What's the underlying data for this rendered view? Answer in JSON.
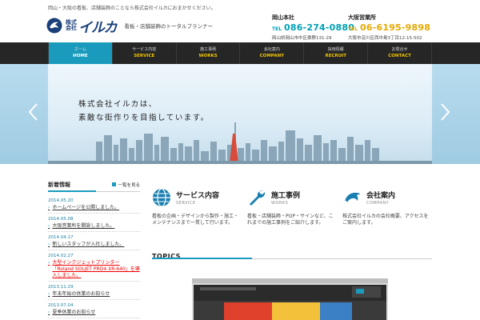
{
  "header": {
    "tagline": "岡山・大阪の看板、店舗装飾のことなら株式会社イルカにおまかせください。",
    "logo_corp": "株式会社",
    "logo_name": "イルカ",
    "logo_sub": "看板・店舗装飾のトータルプランナー",
    "offices": [
      {
        "title": "岡山本社",
        "tel_label": "TEL",
        "tel": "086-274-0880",
        "address": "岡山県岡山市中区桑野131-29",
        "color": "#00a0b8"
      },
      {
        "title": "大阪営業所",
        "tel_label": "TEL",
        "tel": "06-6195-9898",
        "address": "大阪市淀川区西中島3丁目12-15-502",
        "color": "#e6a800"
      }
    ]
  },
  "nav": {
    "items": [
      {
        "jp": "ホーム",
        "en": "HOME",
        "active": true
      },
      {
        "jp": "サービス内容",
        "en": "SERVICE"
      },
      {
        "jp": "施工事例",
        "en": "WORKS"
      },
      {
        "jp": "会社案内",
        "en": "COMPANY"
      },
      {
        "jp": "採用情報",
        "en": "RECRUIT"
      },
      {
        "jp": "お問合せ",
        "en": "CONTACT"
      }
    ]
  },
  "hero": {
    "line1": "株式会社イルカは、",
    "line2": "素敵な街作りを目指しています。"
  },
  "sidebar": {
    "title": "新着情報",
    "list_button": "一覧を見る",
    "news": [
      {
        "date": "2014.05.20",
        "text": "ホームページを公開しました。"
      },
      {
        "date": "2014.05.08",
        "text": "大阪営業所を開設しました。"
      },
      {
        "date": "2014.04.17",
        "text": "新しいスタッフが入社しました。"
      },
      {
        "date": "2014.02.27",
        "text": "大型インクジェットプリンター「Roland SOLJET PRO4 XR-640」を導入しました。",
        "red": true
      },
      {
        "date": "2013.11.29",
        "text": "年末年始の休業のお知らせ"
      },
      {
        "date": "2013.07.04",
        "text": "夏季休業のお知らせ"
      }
    ]
  },
  "services": [
    {
      "title": "サービス内容",
      "en": "SERVICE",
      "icon": "globe-icon",
      "desc": "看板の企画・デザインから製作・施工・メンテナンスまで一貫して行います。"
    },
    {
      "title": "施工事例",
      "en": "WORKS",
      "icon": "wrench-icon",
      "desc": "看板・店舗装飾・POP・サインなど、これまでの施工事例をご紹介します。"
    },
    {
      "title": "会社案内",
      "en": "COMPANY",
      "icon": "dolphin-icon",
      "desc": "株式会社イルカの会社概要、アクセスをご案内します。"
    }
  ],
  "topics": {
    "title": "TOPICS"
  },
  "colors": {
    "accent": "#1a9bbd",
    "nav_bg": "#262626",
    "nav_en": "#f0c400"
  }
}
